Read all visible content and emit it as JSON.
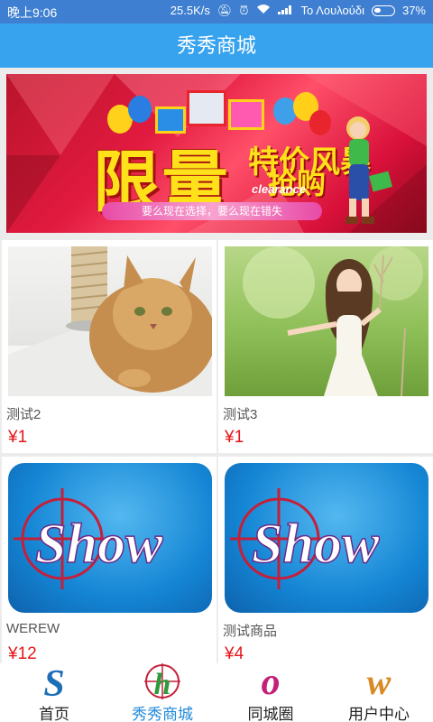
{
  "status_bar": {
    "time": "晚上9:06",
    "speed": "25.5K/s",
    "carrier": "Το Λουλούδι",
    "battery": "37%",
    "battery_level": 0.37
  },
  "header": {
    "title": "秀秀商城"
  },
  "banner": {
    "headline": "限量",
    "sub1": "特价风暴",
    "sub2": "抢购",
    "english": "clearance",
    "tagline": "要么现在选择，要么现在错失"
  },
  "products": [
    {
      "name": "测试2",
      "price": "¥1"
    },
    {
      "name": "测试3",
      "price": "¥1"
    },
    {
      "name": "WEREW",
      "price": "¥12"
    },
    {
      "name": "测试商品",
      "price": "¥4"
    }
  ],
  "show_logo_text": "Show",
  "bottom_nav": [
    {
      "label": "首页",
      "letter": "S",
      "color": "#1d6fb8"
    },
    {
      "label": "秀秀商城",
      "letter": "h",
      "color": "#2f9a3c"
    },
    {
      "label": "同城圈",
      "letter": "o",
      "color": "#c4207a"
    },
    {
      "label": "用户中心",
      "letter": "w",
      "color": "#d98a25"
    }
  ]
}
